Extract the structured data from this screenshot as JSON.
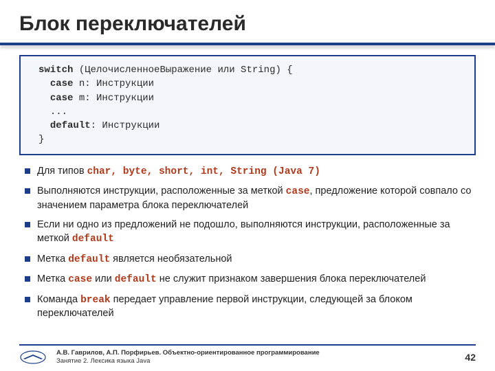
{
  "title": "Блок переключателей",
  "code": {
    "l1a": "switch",
    "l1b": " (ЦелочисленноеВыражение или String) {",
    "l2a": "case",
    "l2b": " n: Инструкции",
    "l3a": "case",
    "l3b": " m: Инструкции",
    "l4": "...",
    "l5a": "default",
    "l5b": ": Инструкции",
    "l6": "}"
  },
  "bullets": {
    "b1_pre": "Для типов ",
    "b1_code": "char, byte, short, int, String (Java 7)",
    "b2_pre": "Выполняются инструкции, расположенные за меткой ",
    "b2_code": "case",
    "b2_post": ", предложение которой совпало со значением параметра блока переключателей",
    "b3_pre": "Если ни одно из предложений не подошло, выполняются инструкции, расположенные за меткой ",
    "b3_code": "default",
    "b4_pre": "Метка ",
    "b4_code": "default",
    "b4_post": " является необязательной",
    "b5_pre": "Метка ",
    "b5_code1": "case",
    "b5_mid": " или ",
    "b5_code2": "default",
    "b5_post": " не служит признаком завершения блока переключателей",
    "b6_pre": "Команда ",
    "b6_code": "break",
    "b6_post": " передает управление первой инструкции, следующей за блоком переключателей"
  },
  "footer": {
    "line1": "А.В. Гаврилов, А.П. Порфирьев. Объектно-ориентированное программирование",
    "line2": "Занятие 2. Лексика языка Java",
    "page": "42"
  }
}
